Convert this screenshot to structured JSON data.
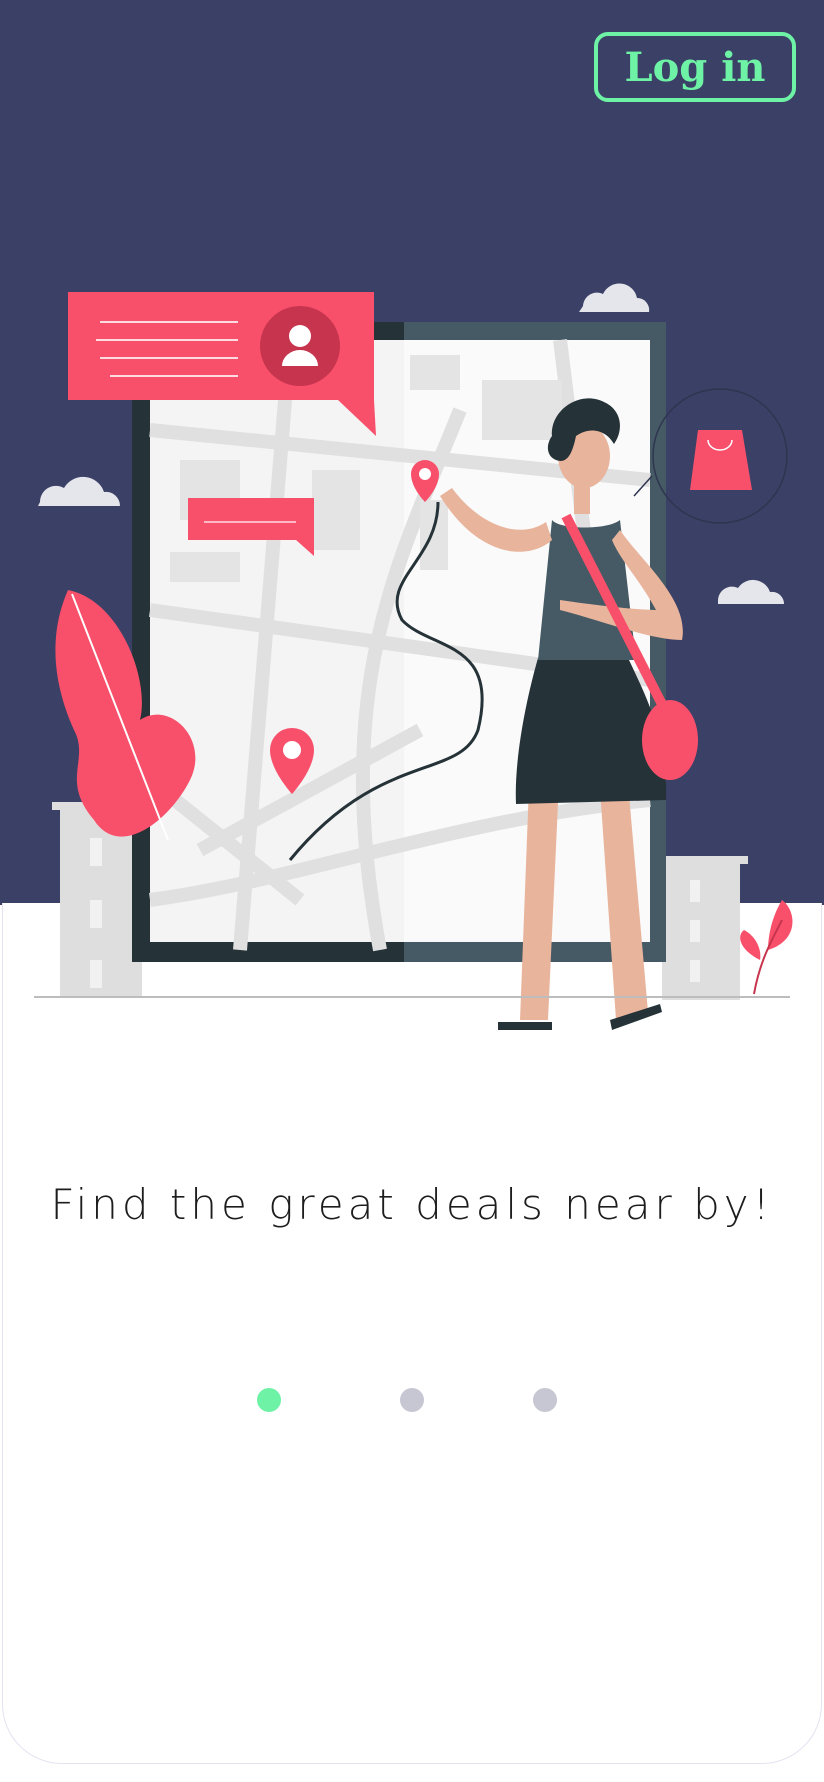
{
  "header": {
    "login_label": "Log in"
  },
  "onboarding": {
    "tagline": "Find the great deals near by!",
    "pager": {
      "total": 3,
      "active_index": 0
    }
  },
  "colors": {
    "header_background": "#3b4066",
    "accent_green": "#6ef2a6",
    "accent_pink": "#f8506b",
    "dot_inactive": "#c6c7d3"
  },
  "icons": [
    "user-icon",
    "location-pin-icon",
    "shopping-bag-icon",
    "cloud-icon",
    "leaf-icon"
  ]
}
